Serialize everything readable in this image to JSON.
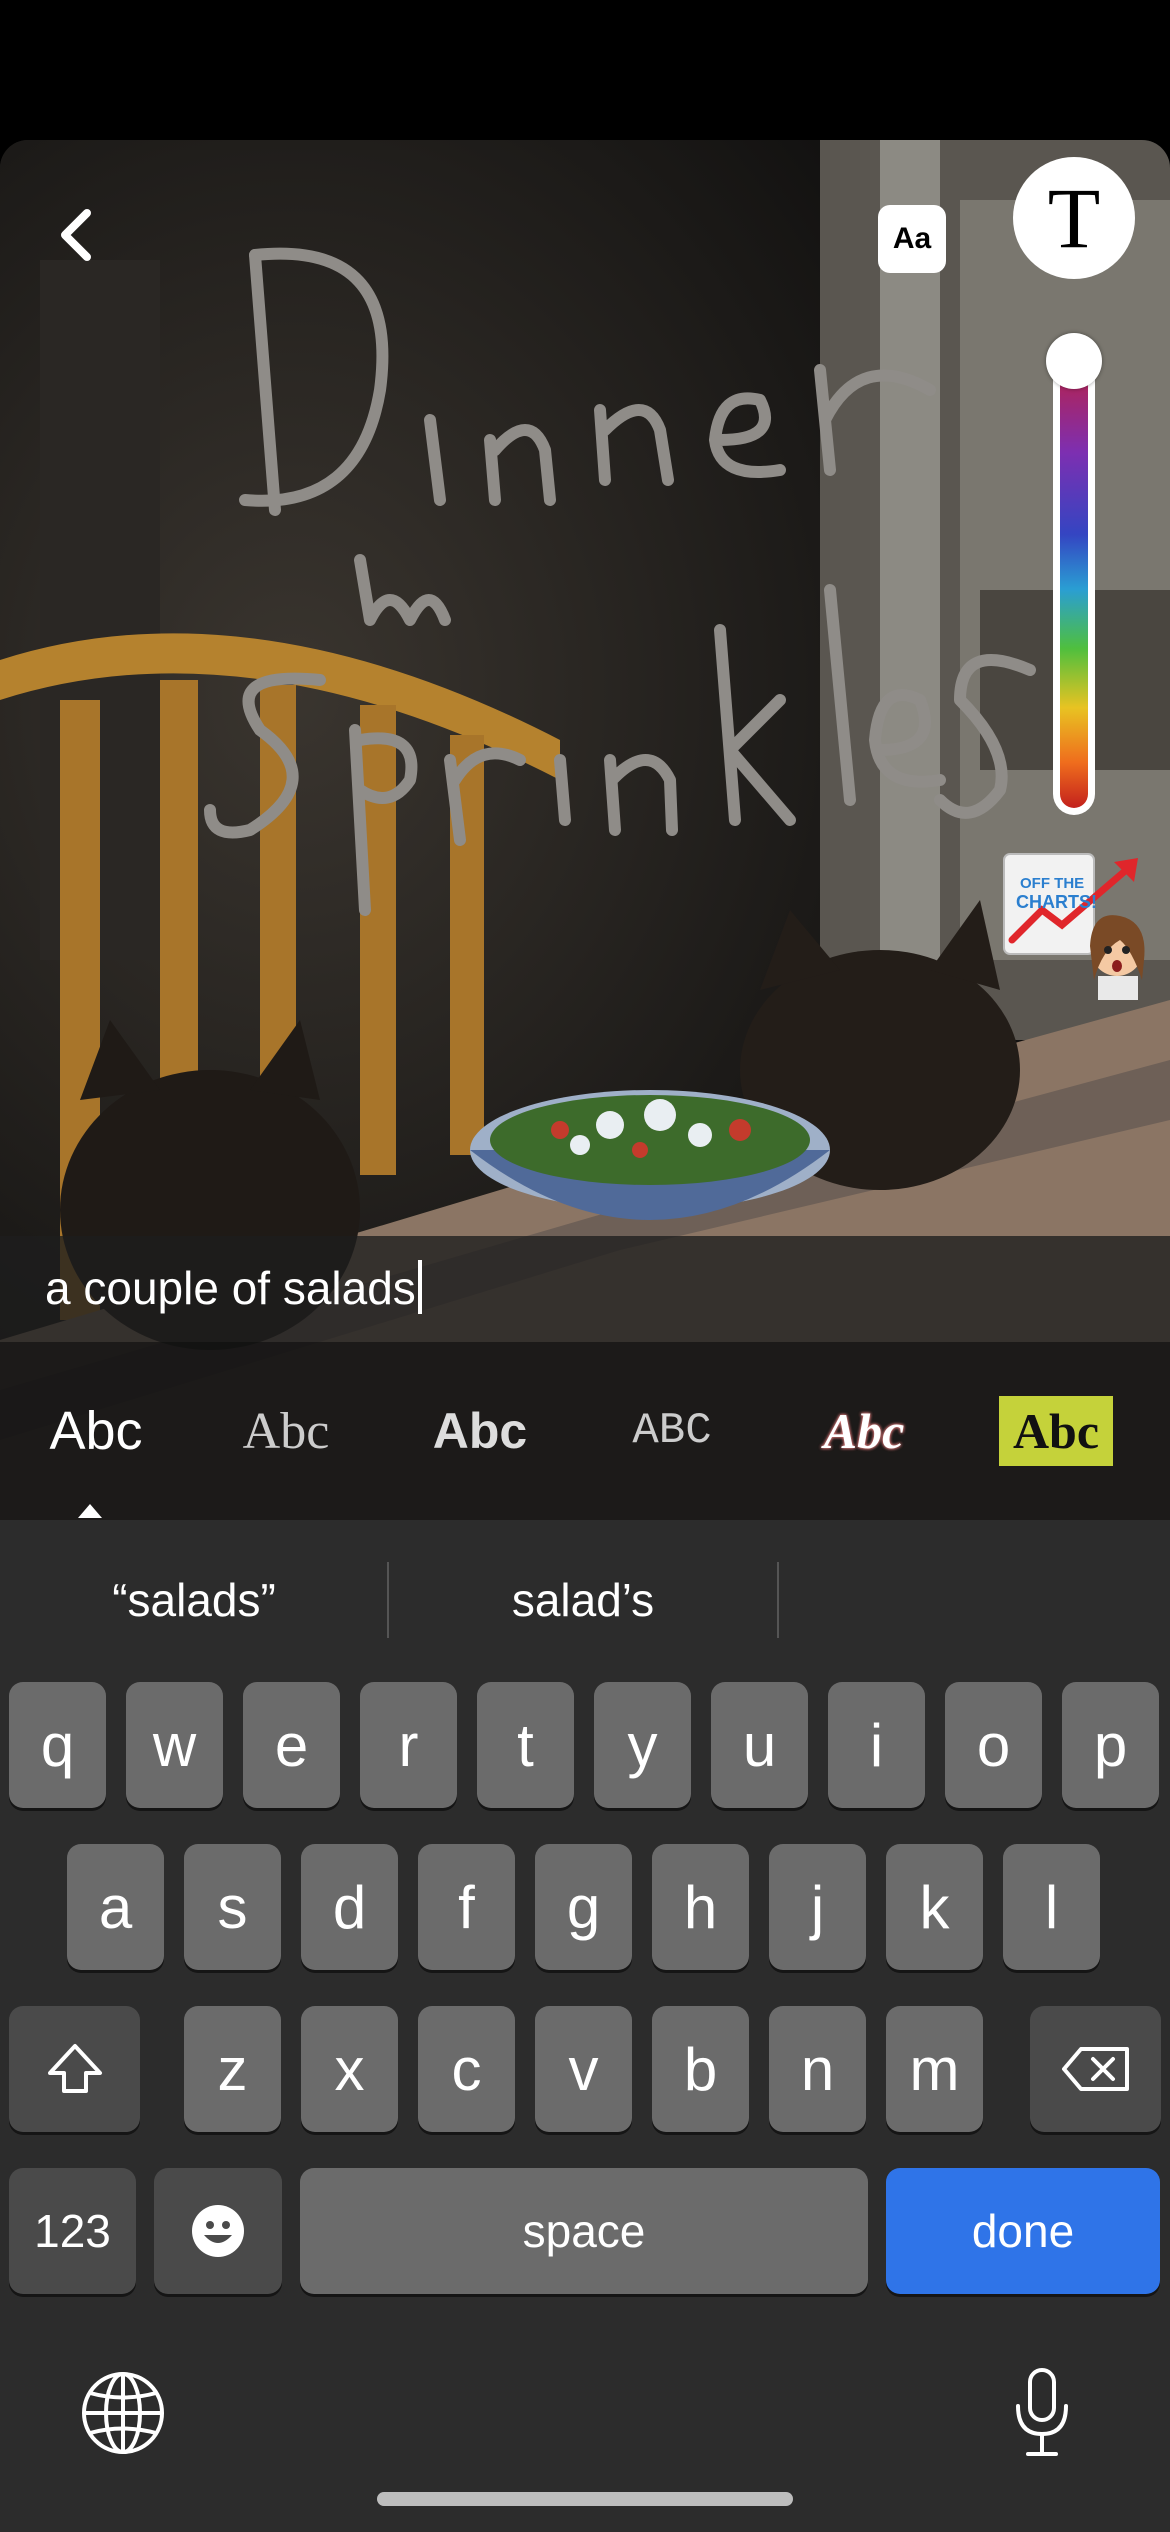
{
  "editor": {
    "aa_label": "Aa",
    "text_tool_label": "T",
    "drawing_text": [
      "Dinner",
      "w",
      "Sprinkles"
    ]
  },
  "sticker": {
    "lines": [
      "OFF THE",
      "CHARTS!"
    ]
  },
  "text_input": {
    "value": "a couple of salads"
  },
  "font_styles": [
    {
      "label": "Abc"
    },
    {
      "label": "Abc"
    },
    {
      "label": "Abc"
    },
    {
      "label": "ABC"
    },
    {
      "label": "Abc"
    },
    {
      "label": "Abc"
    }
  ],
  "keyboard": {
    "suggestions": [
      "“salads”",
      "salad’s"
    ],
    "row1": [
      "q",
      "w",
      "e",
      "r",
      "t",
      "y",
      "u",
      "i",
      "o",
      "p"
    ],
    "row2": [
      "a",
      "s",
      "d",
      "f",
      "g",
      "h",
      "j",
      "k",
      "l"
    ],
    "row3": [
      "z",
      "x",
      "c",
      "v",
      "b",
      "n",
      "m"
    ],
    "numbers_label": "123",
    "space_label": "space",
    "done_label": "done"
  },
  "colors": {
    "done_button": "#2f74e8",
    "highlight_style": "#c5d23a"
  }
}
